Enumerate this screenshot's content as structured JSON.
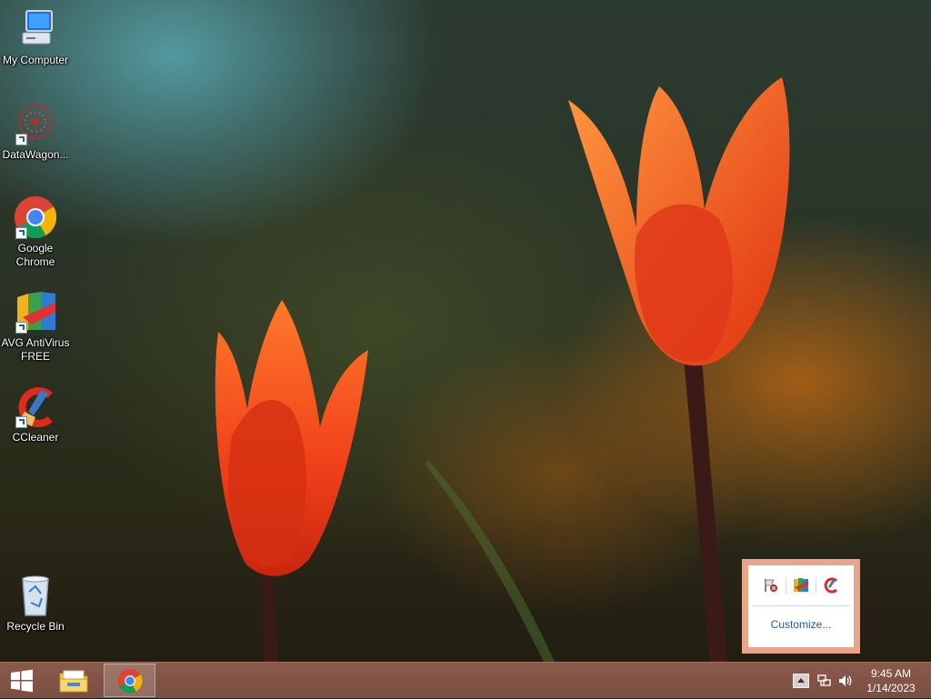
{
  "desktop": {
    "icons": [
      {
        "label": "My Computer"
      },
      {
        "label": "DataWagon..."
      },
      {
        "label": "Google Chrome"
      },
      {
        "label": "AVG AntiVirus FREE"
      },
      {
        "label": "CCleaner"
      },
      {
        "label": "Recycle Bin"
      }
    ]
  },
  "tray_popup": {
    "icons": [
      "action-center-flag-icon",
      "avg-antivirus-tray-icon",
      "ccleaner-tray-icon"
    ],
    "customize_label": "Customize..."
  },
  "taskbar": {
    "pinned": [
      "start-icon",
      "file-explorer-icon",
      "chrome-icon"
    ],
    "tray": [
      "show-hidden-icons-arrow",
      "network-icon",
      "volume-icon"
    ],
    "clock": {
      "time": "9:45 AM",
      "date": "1/14/2023"
    }
  },
  "colors": {
    "taskbar": "#7a4e42",
    "popup_border": "#e9a58a",
    "link": "#1e5aa8"
  }
}
